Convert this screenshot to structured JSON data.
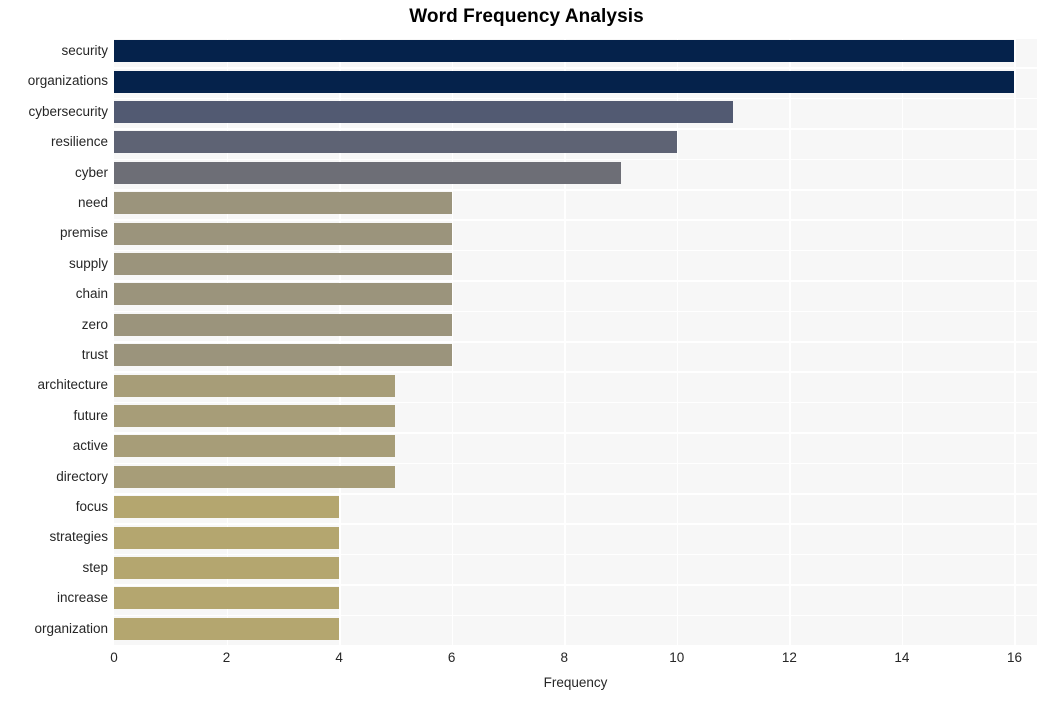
{
  "chart_data": {
    "type": "bar",
    "orientation": "horizontal",
    "title": "Word Frequency Analysis",
    "xlabel": "Frequency",
    "ylabel": "",
    "xlim": [
      0,
      16.4
    ],
    "xticks": [
      0,
      2,
      4,
      6,
      8,
      10,
      12,
      14,
      16
    ],
    "xtick_labels": [
      "0",
      "2",
      "4",
      "6",
      "8",
      "10",
      "12",
      "14",
      "16"
    ],
    "grid": "vertical-white-on-light-gray",
    "legend": "none",
    "background": "#f7f7f7",
    "categories": [
      "security",
      "organizations",
      "cybersecurity",
      "resilience",
      "cyber",
      "need",
      "premise",
      "supply",
      "chain",
      "zero",
      "trust",
      "architecture",
      "future",
      "active",
      "directory",
      "focus",
      "strategies",
      "step",
      "increase",
      "organization"
    ],
    "values": [
      16,
      16,
      11,
      10,
      9,
      6,
      6,
      6,
      6,
      6,
      6,
      5,
      5,
      5,
      5,
      4,
      4,
      4,
      4,
      4
    ],
    "bar_colors": [
      "#05224b",
      "#05224b",
      "#525a72",
      "#5e6374",
      "#6d6e76",
      "#9b947c",
      "#9b947c",
      "#9b947c",
      "#9b947c",
      "#9b947c",
      "#9b947c",
      "#a79d78",
      "#a79d78",
      "#a79d78",
      "#a79d78",
      "#b4a66f",
      "#b4a66f",
      "#b4a66f",
      "#b4a66f",
      "#b4a66f"
    ]
  },
  "colors": {
    "title_text": "#000000",
    "tick_text": "#262626",
    "plot_background": "#f7f7f7",
    "gridline": "#ffffff",
    "page_background": "#ffffff"
  }
}
